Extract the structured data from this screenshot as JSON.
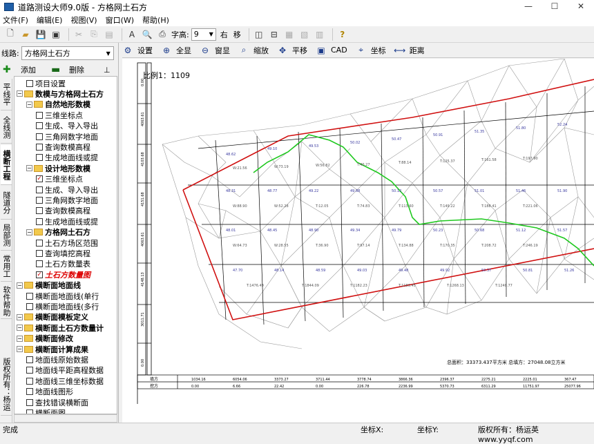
{
  "window": {
    "title": "道路测设大师9.0版 - 方格网土石方",
    "buttons": {
      "minimize": "—",
      "maximize": "☐",
      "close": "✕"
    }
  },
  "menu": [
    {
      "label": "文件(F)"
    },
    {
      "label": "编辑(E)"
    },
    {
      "label": "视图(V)"
    },
    {
      "label": "窗口(W)"
    },
    {
      "label": "帮助(H)"
    }
  ],
  "toolbar": {
    "font_label": "字高:",
    "font_value": "9",
    "right_label": "右",
    "move_label": "移"
  },
  "route": {
    "label": "线路:",
    "value": "方格网土石方"
  },
  "actions": {
    "add": "添加",
    "delete": "删除"
  },
  "vtabs": [
    {
      "label": "平线平差"
    },
    {
      "label": "全线测设"
    },
    {
      "label": "横断工程"
    },
    {
      "label": "隧道分析"
    },
    {
      "label": "局部测设"
    },
    {
      "label": "常用工具"
    },
    {
      "label": "软件帮助"
    },
    {
      "label": "版权所有：杨运英"
    }
  ],
  "tree": [
    {
      "label": "项目设置",
      "level": 1,
      "type": "check"
    },
    {
      "label": "数模与方格网土石方",
      "level": 0,
      "type": "folder",
      "bold": true
    },
    {
      "label": "自然地形数模",
      "level": 1,
      "type": "folder",
      "bold": true
    },
    {
      "label": "三维坐标点",
      "level": 2,
      "type": "check"
    },
    {
      "label": "生成、导入导出",
      "level": 2,
      "type": "check"
    },
    {
      "label": "三角网数字地面",
      "level": 2,
      "type": "check"
    },
    {
      "label": "查询数模高程",
      "level": 2,
      "type": "check"
    },
    {
      "label": "生成地面线或提",
      "level": 2,
      "type": "check"
    },
    {
      "label": "设计地形数模",
      "level": 1,
      "type": "folder",
      "bold": true
    },
    {
      "label": "三维坐标点",
      "level": 2,
      "type": "check",
      "checked": true
    },
    {
      "label": "生成、导入导出",
      "level": 2,
      "type": "check"
    },
    {
      "label": "三角网数字地面",
      "level": 2,
      "type": "check"
    },
    {
      "label": "查询数模高程",
      "level": 2,
      "type": "check"
    },
    {
      "label": "生成地面线或提",
      "level": 2,
      "type": "check"
    },
    {
      "label": "方格网土石方",
      "level": 1,
      "type": "folder",
      "bold": true
    },
    {
      "label": "土石方场区范围",
      "level": 2,
      "type": "check"
    },
    {
      "label": "查询填挖高程",
      "level": 2,
      "type": "check"
    },
    {
      "label": "土石方数量表",
      "level": 2,
      "type": "check"
    },
    {
      "label": "土石方数量图",
      "level": 2,
      "type": "check",
      "checked": true,
      "highlight": true
    },
    {
      "label": "横断面地面线",
      "level": 0,
      "type": "folder",
      "bold": true
    },
    {
      "label": "横断面地面线(单行",
      "level": 1,
      "type": "check"
    },
    {
      "label": "横断面地面线(多行",
      "level": 1,
      "type": "check"
    },
    {
      "label": "横断面模板定义",
      "level": 0,
      "type": "folder",
      "bold": true
    },
    {
      "label": "横断面土石方数量计",
      "level": 0,
      "type": "folder",
      "bold": true
    },
    {
      "label": "横断面修改",
      "level": 0,
      "type": "folder",
      "bold": true
    },
    {
      "label": "横断面计算成果",
      "level": 0,
      "type": "folder",
      "bold": true
    },
    {
      "label": "地面线原始数据",
      "level": 1,
      "type": "check"
    },
    {
      "label": "地面线平距高程数据",
      "level": 1,
      "type": "check"
    },
    {
      "label": "地面线三维坐标数据",
      "level": 1,
      "type": "check"
    },
    {
      "label": "地面线图形",
      "level": 1,
      "type": "check"
    },
    {
      "label": "查找错误横断面",
      "level": 1,
      "type": "check"
    },
    {
      "label": "横断面图",
      "level": 1,
      "type": "check"
    }
  ],
  "cad_tools": [
    {
      "label": "设置",
      "icon": "settings-icon"
    },
    {
      "label": "全显",
      "icon": "zoom-all-icon"
    },
    {
      "label": "窗显",
      "icon": "zoom-window-icon"
    },
    {
      "label": "缩放",
      "icon": "zoom-icon"
    },
    {
      "label": "平移",
      "icon": "pan-icon"
    },
    {
      "label": "CAD",
      "icon": "cad-icon"
    },
    {
      "label": "坐标",
      "icon": "coordinate-icon"
    },
    {
      "label": "距离",
      "icon": "distance-icon"
    }
  ],
  "drawing": {
    "scale": "比例1：1109",
    "totals": "总面积：33373.437平方米    总填方：27048.08立方米",
    "summary_rows": [
      {
        "label": "填方",
        "values": [
          "1034.16",
          "6054.06",
          "3373.27",
          "3711.44",
          "3778.74",
          "3866.36",
          "2396.37",
          "2275.21",
          "2225.01",
          "367.47"
        ]
      },
      {
        "label": "挖方",
        "values": [
          "0.00",
          "6.66",
          "22.42",
          "0.00",
          "226.78",
          "2236.99",
          "5370.73",
          "6311.29",
          "11751.97",
          "25077.96"
        ]
      }
    ],
    "row_labels": [
      "0.00",
      "4063.61",
      "4103.68",
      "4151.68",
      "4063.61",
      "4148.13",
      "3011.71",
      "0.00"
    ]
  },
  "statusbar": {
    "state": "完成",
    "x_label": "坐标X:",
    "y_label": "坐标Y:",
    "copyright": "版权所有：杨运英 www.yyqf.com"
  }
}
